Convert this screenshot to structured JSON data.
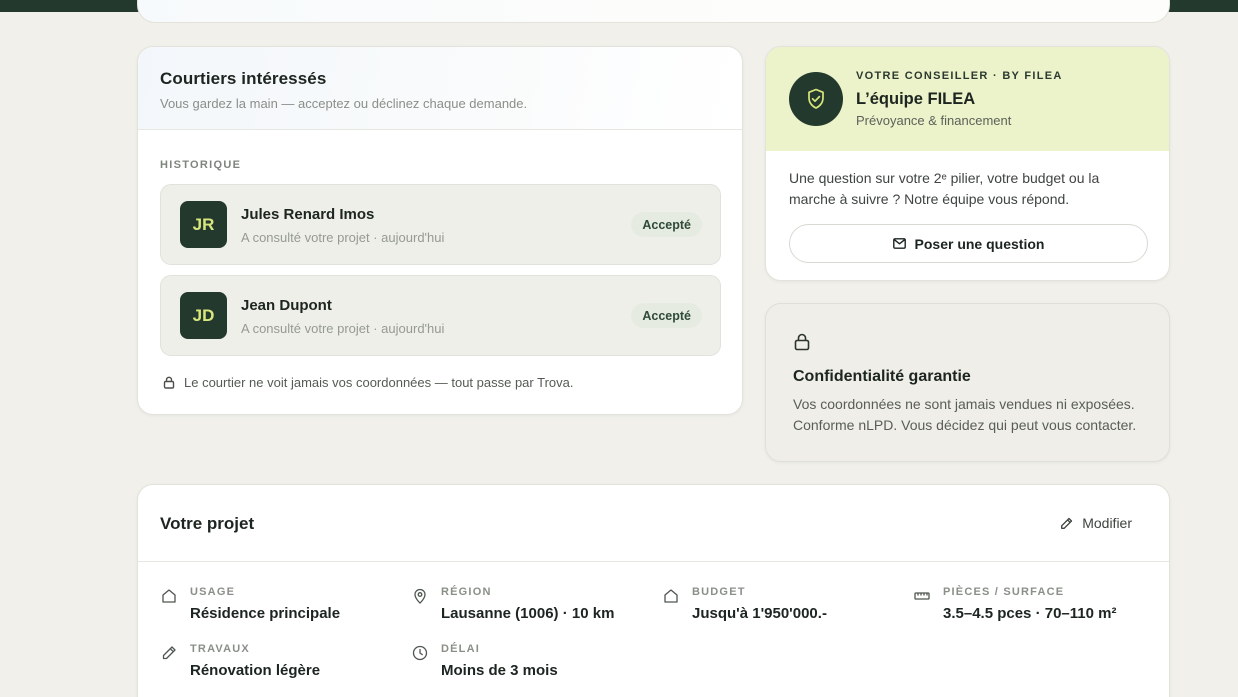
{
  "colors": {
    "dark_green": "#24392e",
    "accent_lime": "#d9e67e",
    "advisor_bg": "#ecf2c9",
    "page_bg": "#f1f0ea",
    "badge_bg": "#e6ebe2"
  },
  "courtiers": {
    "title": "Courtiers intéressés",
    "subtitle": "Vous gardez la main — acceptez ou déclinez chaque demande.",
    "section_label": "HISTORIQUE",
    "brokers": [
      {
        "initials": "JR",
        "name": "Jules Renard Imos",
        "meta": "A consulté votre projet · aujourd'hui",
        "status": "Accepté"
      },
      {
        "initials": "JD",
        "name": "Jean Dupont",
        "meta": "A consulté votre projet · aujourd'hui",
        "status": "Accepté"
      }
    ],
    "note": "Le courtier ne voit jamais vos coordonnées — tout passe par Trova.",
    "note_icon": "lock-icon"
  },
  "advisor": {
    "kicker": "VOTRE CONSEILLER · BY FILEA",
    "name": "L’équipe FILEA",
    "role": "Prévoyance & financement",
    "text": "Une question sur votre 2ᵉ pilier, votre budget ou la marche à suivre ? Notre équipe vous répond.",
    "button_label": "Poser une question",
    "icon": "shield-check-icon",
    "button_icon": "mail-icon"
  },
  "privacy": {
    "title": "Confidentialité garantie",
    "text": "Vos coordonnées ne sont jamais vendues ni exposées. Conforme nLPD. Vous décidez qui peut vous contacter.",
    "icon": "lock-icon"
  },
  "project": {
    "title": "Votre projet",
    "edit_label": "Modifier",
    "edit_icon": "pencil-icon",
    "facts": [
      {
        "label": "USAGE",
        "value": "Résidence principale",
        "icon": "home-icon"
      },
      {
        "label": "RÉGION",
        "value": "Lausanne (1006) · 10 km",
        "icon": "map-pin-icon"
      },
      {
        "label": "BUDGET",
        "value": "Jusqu'à 1'950'000.-",
        "icon": "home-icon"
      },
      {
        "label": "PIÈCES / SURFACE",
        "value": "3.5–4.5 pces · 70–110 m²",
        "icon": "ruler-icon"
      },
      {
        "label": "TRAVAUX",
        "value": "Rénovation légère",
        "icon": "pencil-icon"
      },
      {
        "label": "DÉLAI",
        "value": "Moins de 3 mois",
        "icon": "clock-icon"
      }
    ]
  }
}
